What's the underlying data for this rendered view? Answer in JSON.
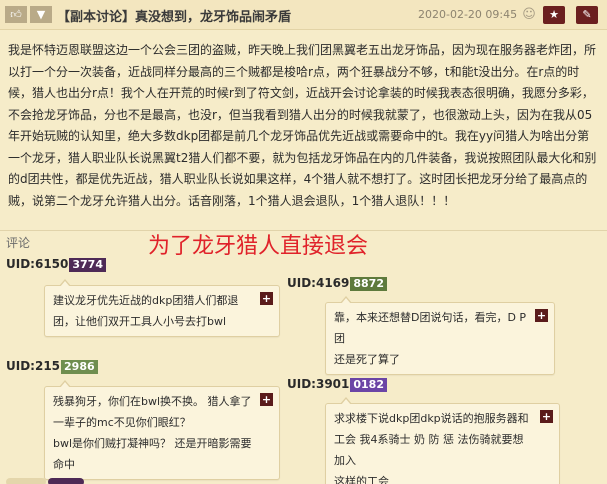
{
  "header": {
    "thumb_icon": "thumbs-up-icon",
    "chevron_icon": "chevron-down-icon",
    "title": "【副本讨论】真没想到，龙牙饰品闹矛盾",
    "date": "2020-02-20 09:45",
    "icons": [
      "user-icon",
      "star-icon",
      "comment-icon"
    ]
  },
  "post": {
    "text": "我是怀特迈恩联盟这边一个公会三团的盗贼，昨天晚上我们团黑翼老五出龙牙饰品，因为现在服务器老炸团，所以打一个分一次装备，近战同样分最高的三个贼都是梭哈r点，两个狂暴战分不够，t和能t没出分。在r点的时候，猎人也出分r点！我个人在开荒的时候r到了符文剑，近战开会讨论拿装的时候我表态很明确，我愿分多彩，不会抢龙牙饰品，分也不是最高，也没r，但当我看到猎人出分的时候我就蒙了，也很激动上头，因为在我从05年开始玩贼的认知里，绝大多数dkp团都是前几个龙牙饰品优先近战或需要命中的t。我在yy问猎人为啥出分第一个龙牙，猎人职业队长说黑翼t2猎人们都不要，就为包括龙牙饰品在内的几件装备，我说按照团队最大化和别的d团共性，都是优先近战，猎人职业队长说如果这样，4个猎人就不想打了。这时团长把龙牙分给了最高点的贼，说第二个龙牙允许猎人出分。话音刚落，1个猎人退会退队，1个猎人退队！！！"
  },
  "comments_label": "评论",
  "annotation": "为了龙牙猎人直接退会",
  "comments": [
    {
      "uid": "UID:6150",
      "badge": "3774",
      "badge_color": "#4e2a56",
      "text_lines": [
        "建议龙牙优先近战的dkp团猎人们都退",
        "团，让他们双开工具人小号去打bwl"
      ]
    },
    {
      "uid": "UID:4169",
      "badge": "8872",
      "badge_color": "#5e7a3c",
      "text_lines": [
        "靠，本来还想替D团说句话，看完，D P团",
        "还是死了算了"
      ]
    },
    {
      "uid": "UID:215",
      "badge": "2986",
      "badge_color": "#6f8e4f",
      "text_lines": [
        "残暴狗牙，你们在bwl换不换。 猎人拿了",
        "一辈子的mc不见你们眼红？",
        "bwl是你们贼打凝神吗？ 还是开暗影需要命中"
      ]
    },
    {
      "uid": "UID:3901",
      "badge": "0182",
      "badge_color": "#6b45a6",
      "text_lines": [
        "求求楼下说dkp团dkp说话的抱服务器和",
        "工会 我4系骑士 奶 防 惩 法伤骑就要想加入",
        "这样的工会"
      ]
    }
  ],
  "colors": {
    "background": "#f6ecc9",
    "header_bg": "#f3e6bf",
    "annotation": "#e0222a",
    "bubble_bg": "#fbf4dc",
    "plus_icon": "#5a1b1b"
  }
}
